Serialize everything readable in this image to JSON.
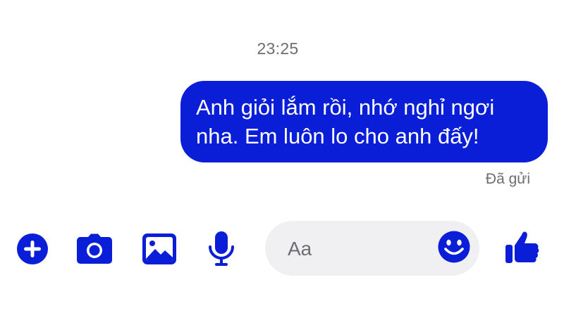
{
  "conversation": {
    "timestamp": "23:25",
    "message": {
      "text": "Anh giỏi lắm rồi, nhớ nghỉ ngơi\nnha. Em luôn lo cho anh đấy!",
      "status": "Đã gửi"
    }
  },
  "composer": {
    "placeholder": "Aa",
    "value": ""
  },
  "toolbar": {
    "icons": [
      "plus-icon",
      "camera-icon",
      "image-icon",
      "microphone-icon",
      "emoji-icon",
      "thumbs-up-icon"
    ]
  },
  "colors": {
    "accent": "#0a1ed8",
    "bubble_text": "#ffffff",
    "muted_text": "#6d6d72",
    "input_bg": "#f0f0f2"
  }
}
